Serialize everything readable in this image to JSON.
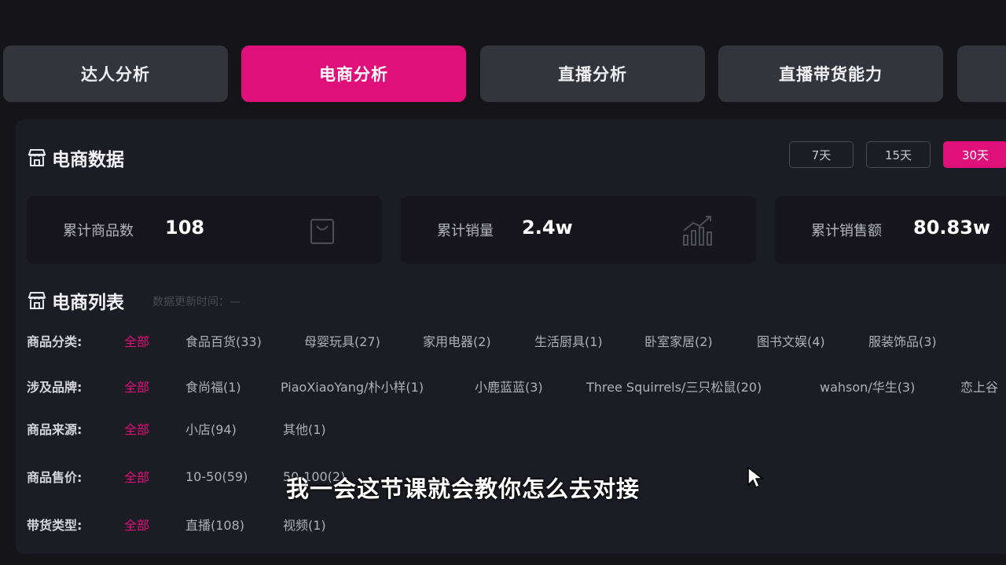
{
  "tabs": [
    {
      "label": "达人分析"
    },
    {
      "label": "电商分析"
    },
    {
      "label": "直播分析"
    },
    {
      "label": "直播带货能力"
    }
  ],
  "ecommerce_data": {
    "title": "电商数据",
    "periods": [
      "7天",
      "15天",
      "30天"
    ],
    "active_period": "30天",
    "stats": [
      {
        "label": "累计商品数",
        "value": "108",
        "icon": "shopping-bag-icon"
      },
      {
        "label": "累计销量",
        "value": "2.4w",
        "icon": "growth-chart-icon"
      },
      {
        "label": "累计销售额",
        "value": "80.83w",
        "icon": "none"
      }
    ]
  },
  "ecommerce_list": {
    "title": "电商列表",
    "update_time": "数据更新时间：—",
    "filters": [
      {
        "label": "商品分类:",
        "options": [
          "全部",
          "食品百货(33)",
          "母婴玩具(27)",
          "家用电器(2)",
          "生活厨具(1)",
          "卧室家居(2)",
          "图书文娱(4)",
          "服装饰品(3)"
        ]
      },
      {
        "label": "涉及品牌:",
        "options": [
          "全部",
          "食尚福(1)",
          "PiaoXiaoYang/朴小样(1)",
          "小鹿蓝蓝(3)",
          "Three Squirrels/三只松鼠(20)",
          "wahson/华生(3)",
          "恋上谷"
        ]
      },
      {
        "label": "商品来源:",
        "options": [
          "全部",
          "小店(94)",
          "其他(1)"
        ]
      },
      {
        "label": "商品售价:",
        "options": [
          "全部",
          "10-50(59)",
          "50-100(2)"
        ]
      },
      {
        "label": "带货类型:",
        "options": [
          "全部",
          "直播(108)",
          "视频(1)"
        ]
      }
    ]
  },
  "subtitle": "我一会这节课就会教你怎么去对接",
  "colors": {
    "accent": "#e0107a",
    "background": "#141419",
    "panel": "#1c1c24",
    "tab": "#34343c"
  }
}
